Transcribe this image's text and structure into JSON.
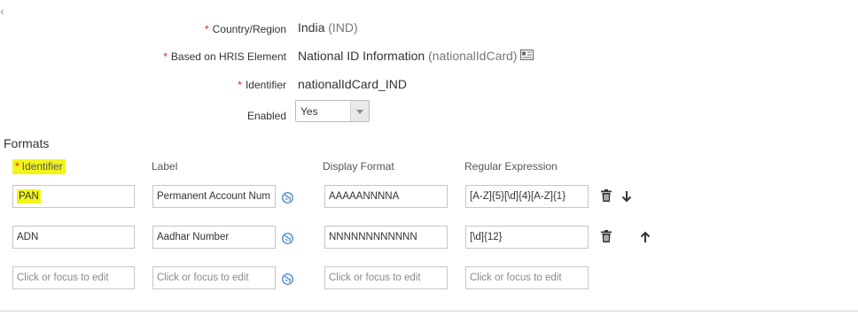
{
  "nav": {
    "back_glyph": "‹"
  },
  "fields": {
    "country": {
      "label": "Country/Region",
      "value": "India",
      "value_suffix": "(IND)",
      "required": "*"
    },
    "hris": {
      "label": "Based on HRIS Element",
      "value": "National ID Information",
      "value_suffix": "(nationalIdCard)",
      "required": "*",
      "icon": "info-card-icon"
    },
    "identifier": {
      "label": "Identifier",
      "value": "nationalIdCard_IND",
      "required": "*"
    },
    "enabled": {
      "label": "Enabled",
      "value": "Yes"
    }
  },
  "formats": {
    "title": "Formats",
    "columns": {
      "identifier": "Identifier",
      "identifier_required": "*",
      "label": "Label",
      "display_format": "Display Format",
      "regex": "Regular Expression"
    },
    "rows": [
      {
        "identifier": "PAN",
        "label": "Permanent Account Num",
        "display_format": "AAAAANNNNA",
        "regex": "[A-Z]{5}[\\d]{4}[A-Z]{1}"
      },
      {
        "identifier": "ADN",
        "label": "Aadhar Number",
        "display_format": "NNNNNNNNNNNN",
        "regex": "[\\d]{12}"
      }
    ],
    "placeholder": "Click or focus to edit"
  },
  "colors": {
    "highlight": "#f3f51a",
    "required": "#d9281e",
    "globe": "#3a7bbf"
  }
}
